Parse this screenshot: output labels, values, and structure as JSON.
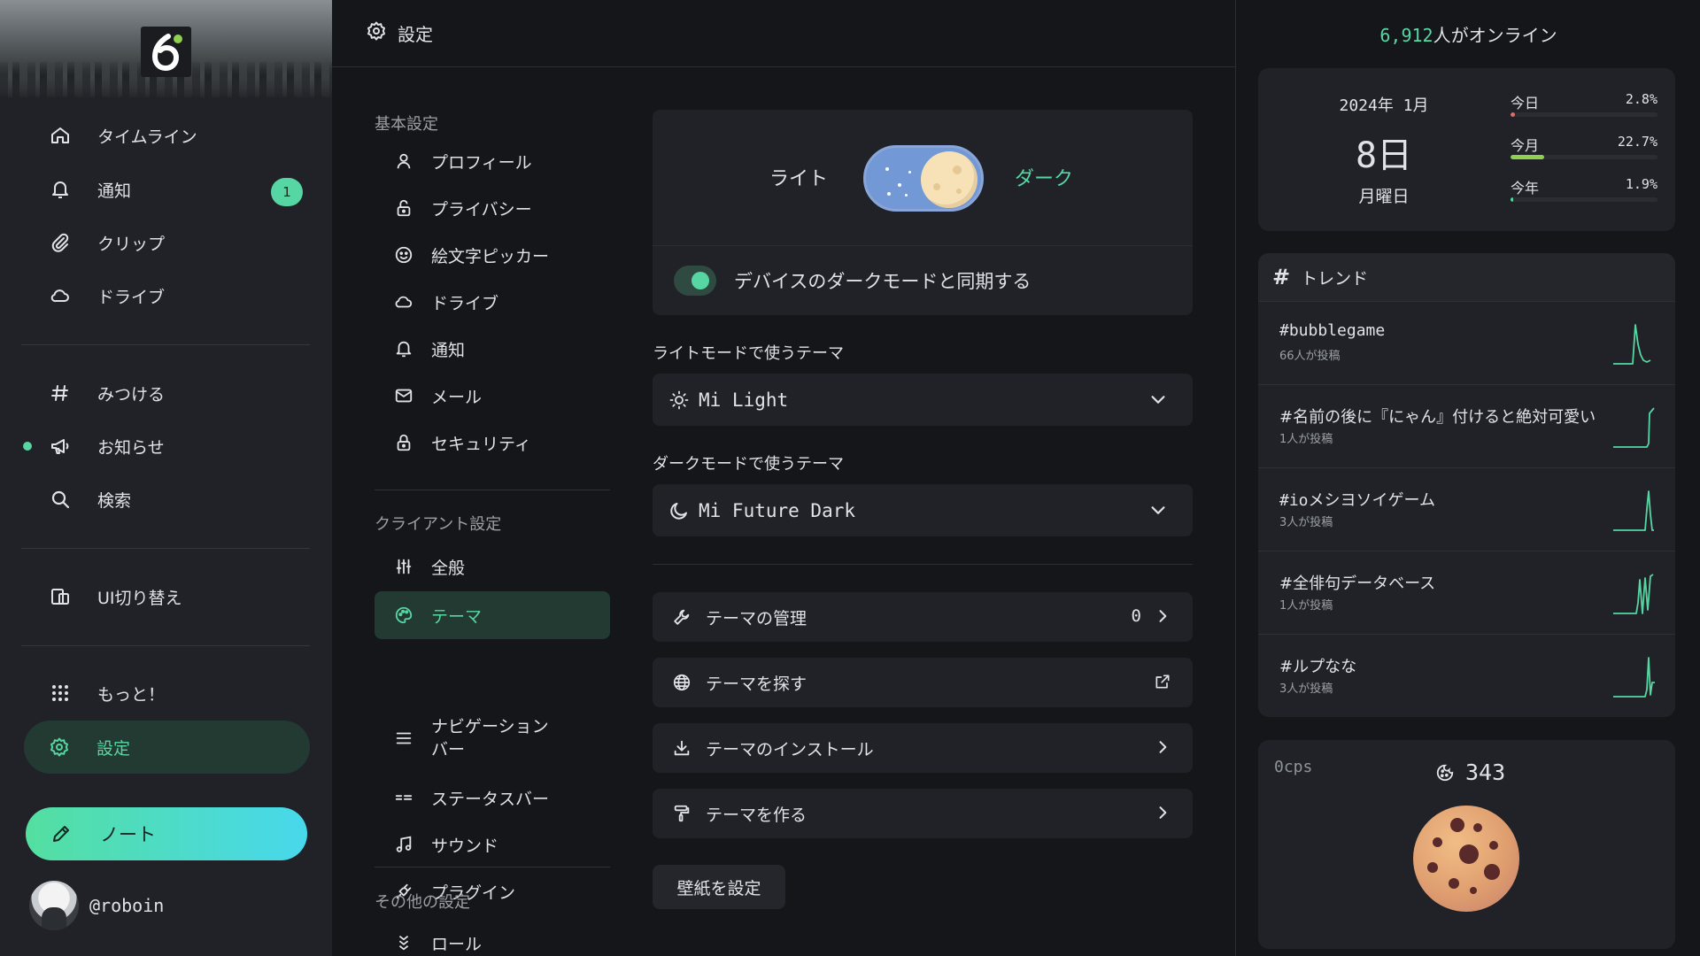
{
  "nav": {
    "items": [
      {
        "label": "タイムライン",
        "icon": "home-icon"
      },
      {
        "label": "通知",
        "icon": "bell-icon",
        "badge": "1"
      },
      {
        "label": "クリップ",
        "icon": "paperclip-icon"
      },
      {
        "label": "ドライブ",
        "icon": "cloud-icon"
      },
      {
        "label": "みつける",
        "icon": "hash-icon"
      },
      {
        "label": "お知らせ",
        "icon": "megaphone-icon"
      },
      {
        "label": "検索",
        "icon": "search-icon"
      },
      {
        "label": "UI切り替え",
        "icon": "ui-switch-icon"
      },
      {
        "label": "もっと！",
        "icon": "grid-dots-icon"
      },
      {
        "label": "設定",
        "icon": "gear-icon",
        "active": true
      }
    ],
    "note_button": "ノート",
    "username": "@roboin"
  },
  "header": {
    "title": "設定"
  },
  "categories": {
    "basic_title": "基本設定",
    "basic": [
      "プロフィール",
      "プライバシー",
      "絵文字ピッカー",
      "ドライブ",
      "通知",
      "メール",
      "セキュリティ"
    ],
    "client_title": "クライアント設定",
    "client": [
      "全般",
      "テーマ",
      "ナビゲーション\nバー",
      "ステータスバー",
      "サウンド",
      "プラグイン"
    ],
    "other_title": "その他の設定",
    "other": [
      "ロール"
    ]
  },
  "theme": {
    "light_label": "ライト",
    "dark_label": "ダーク",
    "sync_label": "デバイスのダークモードと同期する",
    "light_theme_label": "ライトモードで使うテーマ",
    "light_theme_value": "Mi Light",
    "dark_theme_label": "ダークモードで使うテーマ",
    "dark_theme_value": "Mi Future Dark",
    "manage_label": "テーマの管理",
    "manage_count": "0",
    "find_label": "テーマを探す",
    "install_label": "テーマのインストール",
    "make_label": "テーマを作る",
    "wallpaper_label": "壁紙を設定"
  },
  "widgets": {
    "online_count": "6,912",
    "online_suffix": "人がオンライン",
    "calendar": {
      "year_month": "2024年 1月",
      "day": "8日",
      "weekday": "月曜日",
      "stats": [
        {
          "label": "今日",
          "value": "2.8%",
          "fraction": 0.028,
          "color": "#e06c6c"
        },
        {
          "label": "今月",
          "value": "22.7%",
          "fraction": 0.227,
          "color": "#8fd14f"
        },
        {
          "label": "今年",
          "value": "1.9%",
          "fraction": 0.019,
          "color": "#56d6a2"
        }
      ]
    },
    "trends_title": "トレンド",
    "trends": [
      {
        "tag": "#bubblegame",
        "count": "66人が投稿"
      },
      {
        "tag": "#名前の後に『にゃん』付けると絶対可愛い",
        "count": "1人が投稿"
      },
      {
        "tag": "#ioメシヨソイゲーム",
        "count": "3人が投稿"
      },
      {
        "tag": "#全俳句データベース",
        "count": "1人が投稿"
      },
      {
        "tag": "#ルプなな",
        "count": "3人が投稿"
      }
    ],
    "cookie": {
      "cps": "0cps",
      "score": "343"
    }
  }
}
